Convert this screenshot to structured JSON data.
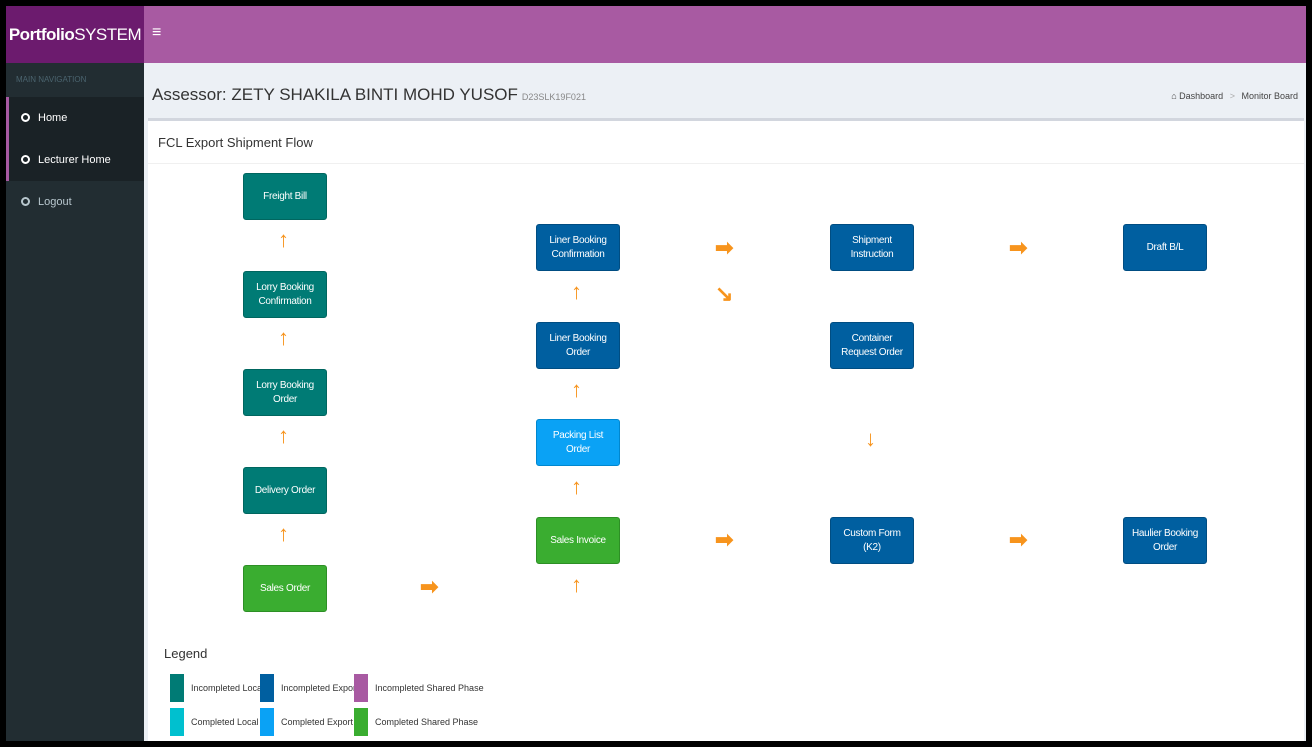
{
  "app": {
    "logo_bold": "Portfolio",
    "logo_rest": "SYSTEM",
    "menu_toggle": "≡"
  },
  "sidebar": {
    "header": "MAIN NAVIGATION",
    "items": [
      {
        "label": "Home"
      },
      {
        "label": "Lecturer Home"
      },
      {
        "label": "Logout"
      }
    ]
  },
  "header": {
    "title": "Assessor: ZETY SHAKILA BINTI MOHD YUSOF",
    "subtitle": "D23SLK19F021",
    "breadcrumb": {
      "dashboard": "Dashboard",
      "current": "Monitor Board",
      "sep": ">"
    }
  },
  "box": {
    "title": "FCL Export Shipment Flow"
  },
  "nodes": {
    "freight_bill": "Freight Bill",
    "lorry_booking_confirmation": "Lorry Booking Confirmation",
    "lorry_booking_order": "Lorry Booking Order",
    "delivery_order": "Delivery Order",
    "sales_order": "Sales Order",
    "liner_booking_confirmation": "Liner Booking Confirmation",
    "liner_booking_order": "Liner Booking Order",
    "packing_list_order": "Packing List Order",
    "sales_invoice": "Sales Invoice",
    "shipment_instruction": "Shipment Instruction",
    "container_request_order": "Container Request Order",
    "custom_form": "Custom Form (K2)",
    "draft_bl": "Draft B/L",
    "haulier_booking_order": "Haulier Booking Order"
  },
  "arrows": {
    "up": "↑",
    "right": "➡",
    "down": "↓",
    "down_right": "↘"
  },
  "legend": {
    "title": "Legend",
    "items": [
      {
        "label": "Incompleted Local",
        "color": "#007b75"
      },
      {
        "label": "Incompleted Export",
        "color": "#005fa0"
      },
      {
        "label": "Incompleted Shared Phase",
        "color": "#a85aa2"
      },
      {
        "label": "Completed Local",
        "color": "#00c0cf"
      },
      {
        "label": "Completed Export",
        "color": "#0aa2f5"
      },
      {
        "label": "Completed Shared Phase",
        "color": "#3aad30"
      }
    ]
  },
  "colors": {
    "accent": "#a85aa2",
    "logo_bg": "#6c1b6e",
    "sidebar_bg": "#222d32",
    "arrow": "#f7941d"
  }
}
